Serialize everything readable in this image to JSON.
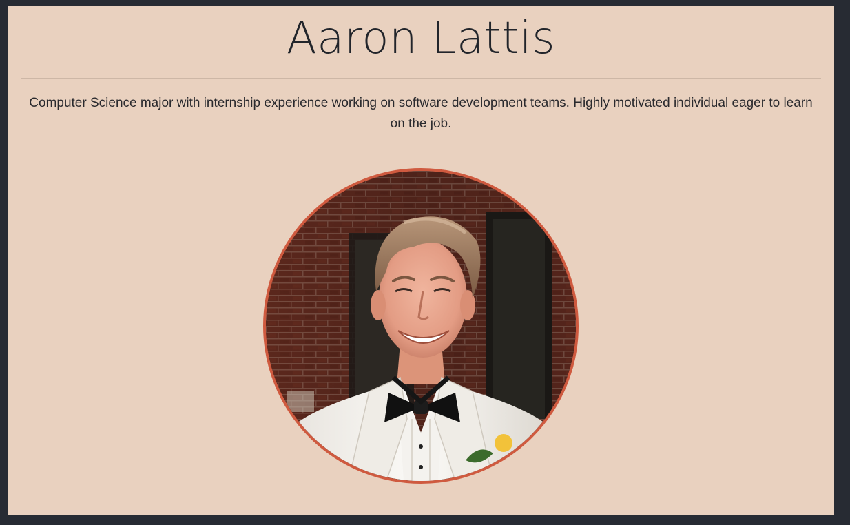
{
  "profile": {
    "name": "Aaron Lattis",
    "bio": "Computer Science major with internship experience working on software development teams. Highly motivated individual eager to learn on the job."
  },
  "colors": {
    "background": "#e9d1bf",
    "frame": "#272b33",
    "photo_border": "#cf5a3f"
  },
  "photo": {
    "icon": "profile-photo"
  }
}
